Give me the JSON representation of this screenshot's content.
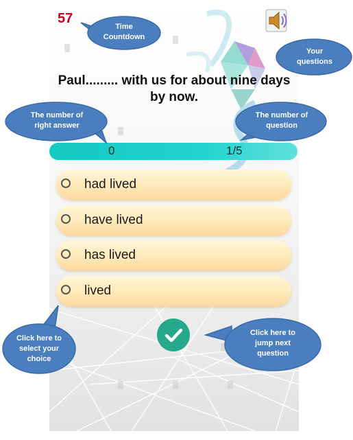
{
  "quiz": {
    "timer": "57",
    "question": "Paul......... with us for about nine days by now.",
    "right_answers": "0",
    "question_progress": "1/5",
    "options": [
      {
        "label": "had lived"
      },
      {
        "label": "have lived"
      },
      {
        "label": "has lived"
      },
      {
        "label": "lived"
      }
    ],
    "sound_icon": "speaker-icon",
    "next_icon": "check-icon"
  },
  "callouts": {
    "timer": "Time Countdown",
    "questions": "Your questions",
    "right_answer": "The number of right answer",
    "question_number": "The number of question",
    "select_choice": "Click here to select your choice",
    "next": "Click here to jump next question"
  },
  "colors": {
    "callout_fill": "#4a7ebf",
    "progress": "#14c9c2",
    "timer": "#d0021b",
    "check_button": "#26a98a"
  }
}
